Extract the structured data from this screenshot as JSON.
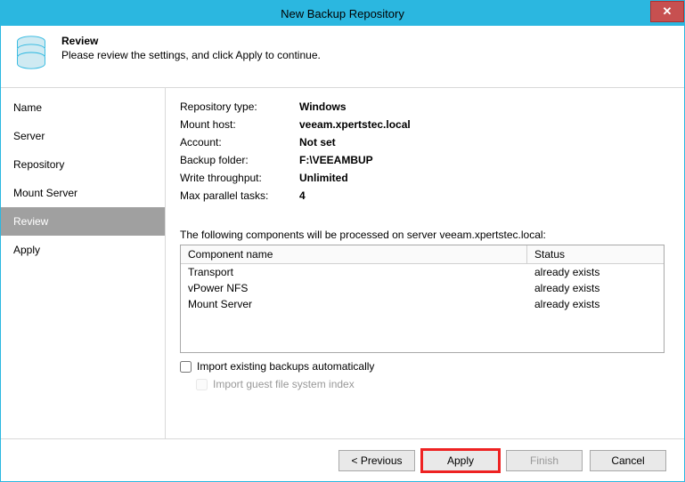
{
  "window": {
    "title": "New Backup Repository"
  },
  "header": {
    "title": "Review",
    "subtitle": "Please review the settings, and click Apply to continue."
  },
  "sidebar": {
    "items": [
      {
        "label": "Name",
        "active": false
      },
      {
        "label": "Server",
        "active": false
      },
      {
        "label": "Repository",
        "active": false
      },
      {
        "label": "Mount Server",
        "active": false
      },
      {
        "label": "Review",
        "active": true
      },
      {
        "label": "Apply",
        "active": false
      }
    ]
  },
  "details": {
    "repo_type_label": "Repository type:",
    "repo_type_value": "Windows",
    "mount_host_label": "Mount host:",
    "mount_host_value": "veeam.xpertstec.local",
    "account_label": "Account:",
    "account_value": "Not set",
    "backup_folder_label": "Backup folder:",
    "backup_folder_value": "F:\\VEEAMBUP",
    "write_tp_label": "Write throughput:",
    "write_tp_value": "Unlimited",
    "max_parallel_label": "Max parallel tasks:",
    "max_parallel_value": "4"
  },
  "components": {
    "intro": "The following components will be processed on server veeam.xpertstec.local:",
    "col_name": "Component name",
    "col_status": "Status",
    "rows": [
      {
        "name": "Transport",
        "status": "already exists"
      },
      {
        "name": "vPower NFS",
        "status": "already exists"
      },
      {
        "name": "Mount Server",
        "status": "already exists"
      }
    ]
  },
  "checkboxes": {
    "import_backups": "Import existing backups automatically",
    "import_index": "Import guest file system index"
  },
  "footer": {
    "previous": "< Previous",
    "apply": "Apply",
    "finish": "Finish",
    "cancel": "Cancel"
  }
}
